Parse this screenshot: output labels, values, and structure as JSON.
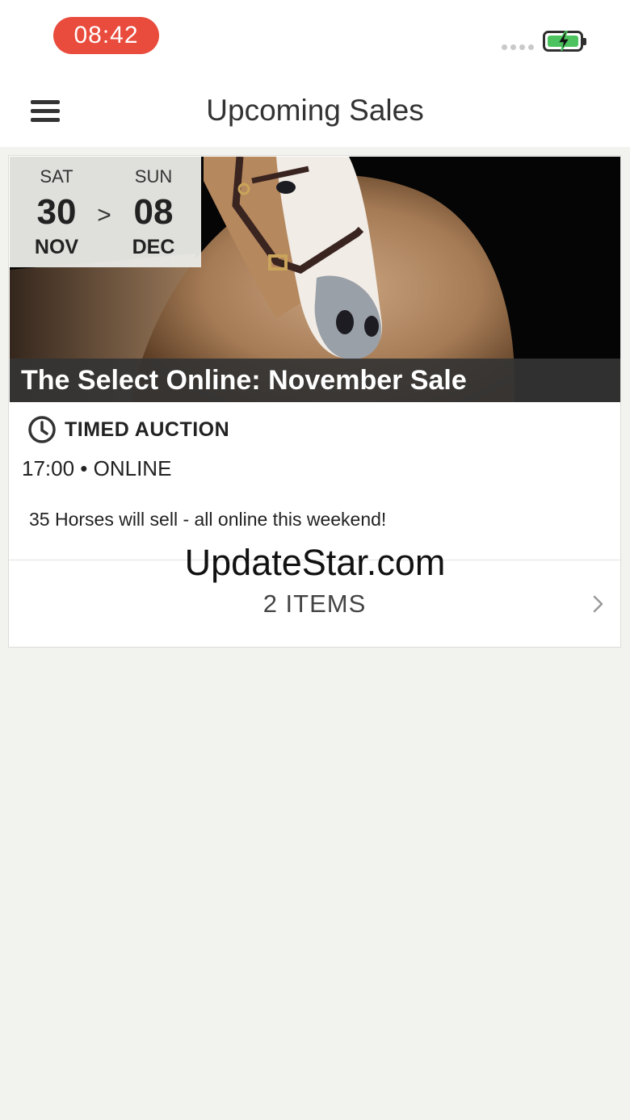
{
  "status_bar": {
    "time": "08:42"
  },
  "nav": {
    "title": "Upcoming Sales",
    "menu_icon": "hamburger-menu-icon"
  },
  "sale": {
    "start": {
      "dow": "SAT",
      "day": "30",
      "month": "NOV"
    },
    "arrow": ">",
    "end": {
      "dow": "SUN",
      "day": "08",
      "month": "DEC"
    },
    "title": "The Select Online: November Sale",
    "auction_type": "TIMED AUCTION",
    "time_location": "17:00 • ONLINE",
    "description": "35 Horses will sell - all online this weekend!",
    "items_label": "2 ITEMS",
    "image_subject": "horse head with halter on black background"
  },
  "watermark": "UpdateStar.com",
  "colors": {
    "time_pill": "#e94b3c",
    "battery_fill": "#4cc35e",
    "background": "#f2f2ee"
  }
}
